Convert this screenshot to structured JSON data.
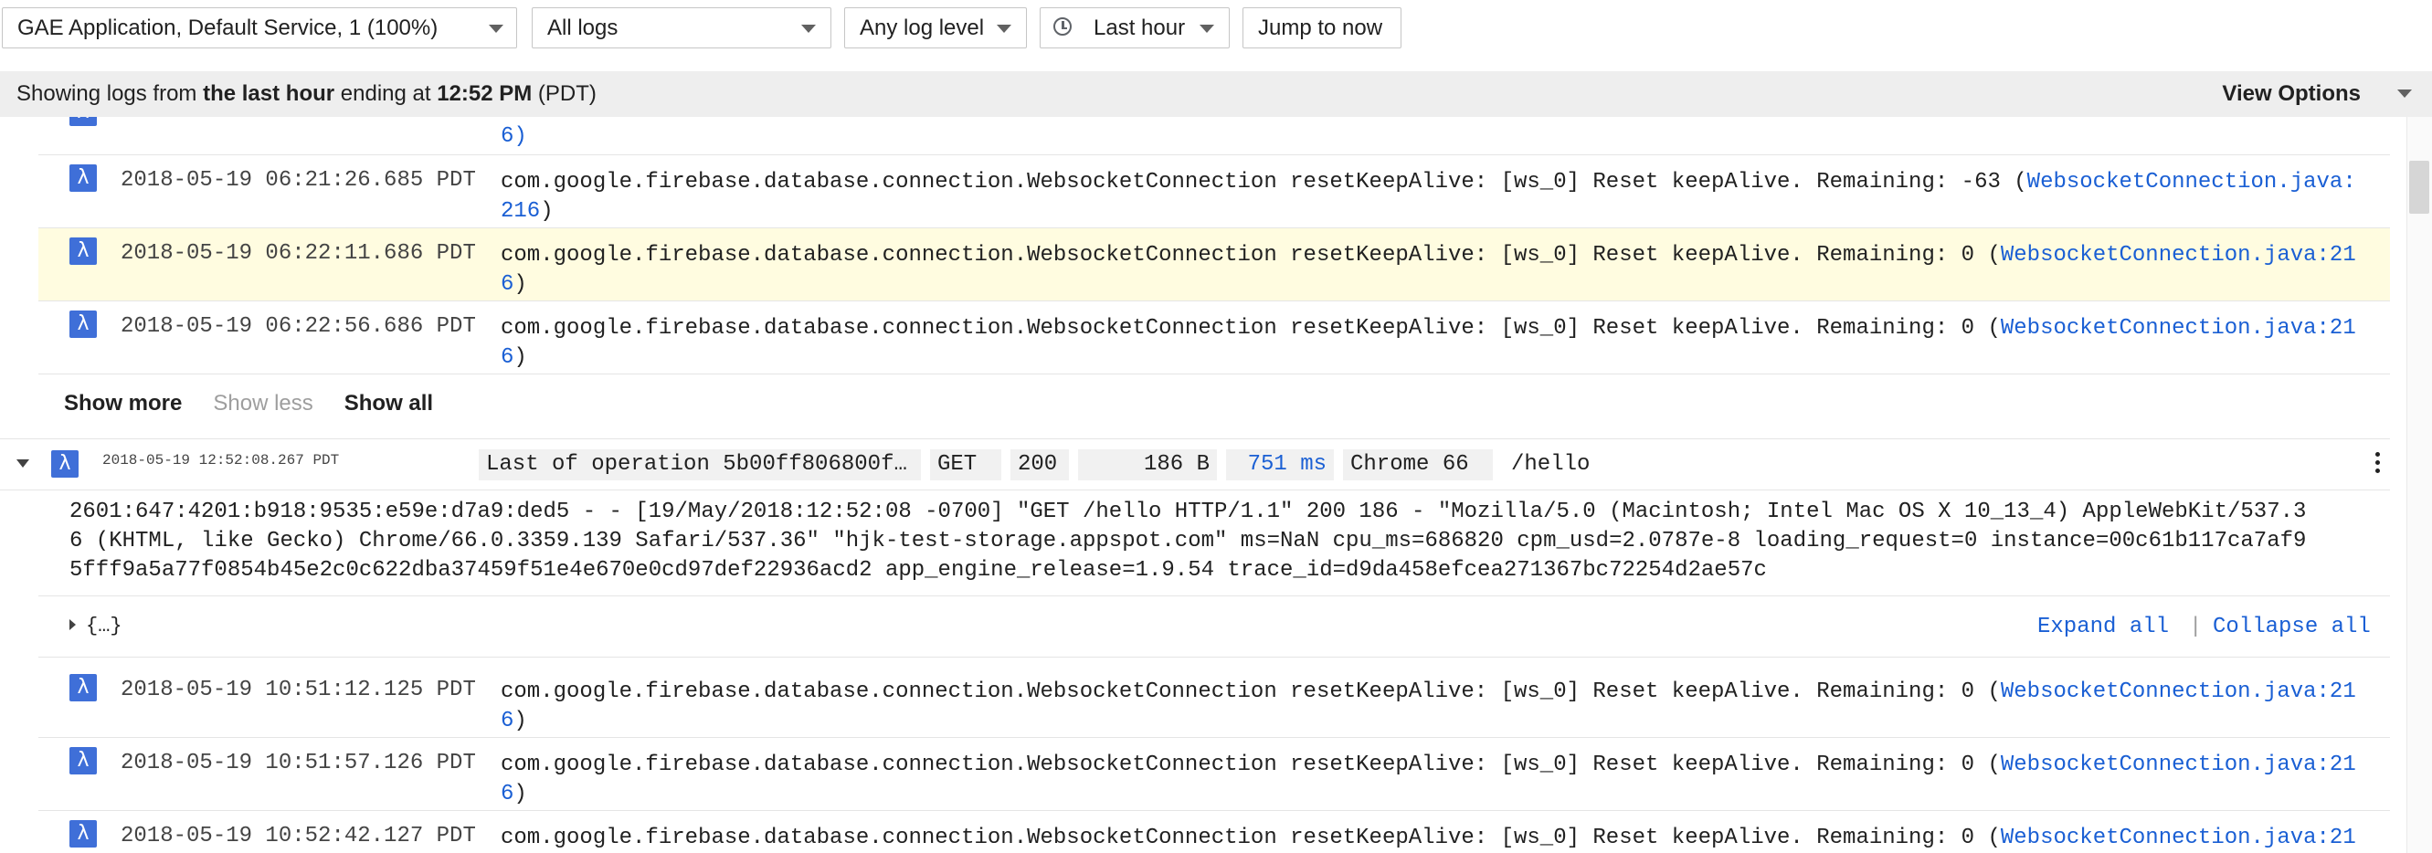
{
  "toolbar": {
    "resource": "GAE Application, Default Service, 1 (100%)",
    "log_name": "All logs",
    "log_level": "Any log level",
    "time_range": "Last hour",
    "jump": "Jump to now"
  },
  "summary": {
    "prefix": "Showing logs from ",
    "range": "the last hour",
    "middle": " ending at ",
    "time": "12:52 PM",
    "suffix": " (PDT)",
    "view_options": "View Options"
  },
  "icons": {
    "lambda": "λ"
  },
  "top_partial": {
    "line2": "6)"
  },
  "entries_before": [
    {
      "timestamp": "2018-05-19 06:21:26.685 PDT",
      "text": "com.google.firebase.database.connection.WebsocketConnection resetKeepAlive: [ws_0] Reset keepAlive. Remaining: -63 (",
      "link": "WebsocketConnection.java:",
      "line2_link": "216",
      "line2_tail": ")"
    },
    {
      "timestamp": "2018-05-19 06:22:11.686 PDT",
      "text": "com.google.firebase.database.connection.WebsocketConnection resetKeepAlive: [ws_0] Reset keepAlive. Remaining: 0 (",
      "link": "WebsocketConnection.java:21",
      "line2_link": "6",
      "line2_tail": ")"
    },
    {
      "timestamp": "2018-05-19 06:22:56.686 PDT",
      "text": "com.google.firebase.database.connection.WebsocketConnection resetKeepAlive: [ws_0] Reset keepAlive. Remaining: 0 (",
      "link": "WebsocketConnection.java:21",
      "line2_link": "6",
      "line2_tail": ")"
    }
  ],
  "show": {
    "more": "Show more",
    "less": "Show less",
    "all": "Show all"
  },
  "request": {
    "timestamp": "2018-05-19 12:52:08.267 PDT",
    "operation": "Last of operation 5b00ff806800f…",
    "method": "GET",
    "status": "200",
    "size": "186 B",
    "latency": "751 ms",
    "agent": "Chrome 66",
    "path": "/hello"
  },
  "payload": {
    "line1": "2601:647:4201:b918:9535:e59e:d7a9:ded5 - - [19/May/2018:12:52:08 -0700] \"GET /hello HTTP/1.1\" 200 186 - \"Mozilla/5.0 (Macintosh; Intel Mac OS X 10_13_4) AppleWebKit/537.3",
    "line2": "6 (KHTML, like Gecko) Chrome/66.0.3359.139 Safari/537.36\" \"hjk-test-storage.appspot.com\" ms=NaN cpu_ms=686820 cpm_usd=2.0787e-8 loading_request=0 instance=00c61b117ca7af9",
    "line3": "5fff9a5a77f0854b45e2c0c622dba37459f51e4e670e0cd97def22936acd2 app_engine_release=1.9.54 trace_id=d9da458efcea271367bc72254d2ae57c"
  },
  "json": {
    "label": "{…}",
    "expand": "Expand all",
    "sep": "|",
    "collapse": "Collapse all"
  },
  "entries_after": [
    {
      "timestamp": "2018-05-19 10:51:12.125 PDT",
      "text": "com.google.firebase.database.connection.WebsocketConnection resetKeepAlive: [ws_0] Reset keepAlive. Remaining: 0 (",
      "link": "WebsocketConnection.java:21",
      "line2_link": "6",
      "line2_tail": ")"
    },
    {
      "timestamp": "2018-05-19 10:51:57.126 PDT",
      "text": "com.google.firebase.database.connection.WebsocketConnection resetKeepAlive: [ws_0] Reset keepAlive. Remaining: 0 (",
      "link": "WebsocketConnection.java:21",
      "line2_link": "6",
      "line2_tail": ")"
    },
    {
      "timestamp": "2018-05-19 10:52:42.127 PDT",
      "text": "com.google.firebase.database.connection.WebsocketConnection resetKeepAlive: [ws_0] Reset keepAlive. Remaining: 0 (",
      "link": "WebsocketConnection.java:21",
      "line2_link": "",
      "line2_tail": ""
    }
  ],
  "colors": {
    "accent": "#3f6fd8",
    "link": "#1a5fd4",
    "highlight_row": "#fffce0",
    "summary_bg": "#eeeeee"
  }
}
